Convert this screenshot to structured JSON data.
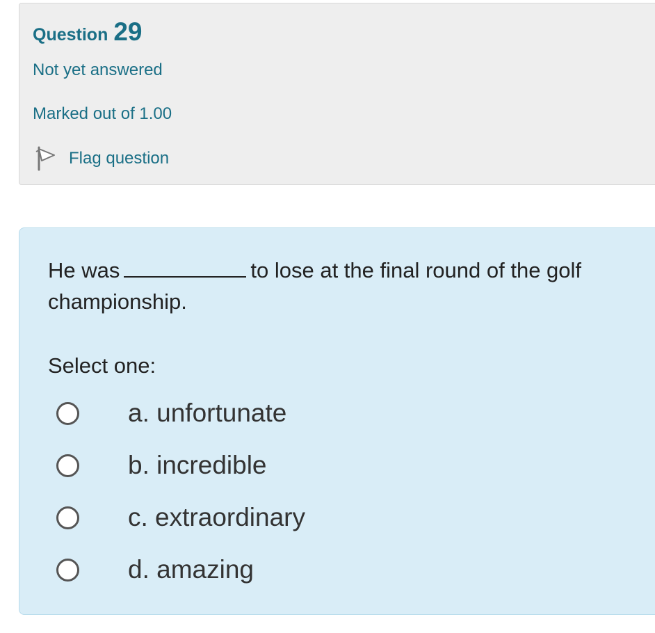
{
  "info": {
    "question_label": "Question",
    "question_number": "29",
    "state": "Not yet answered",
    "grade": "Marked out of 1.00",
    "flag_label": "Flag question"
  },
  "question": {
    "text_before": "He was",
    "text_after": "to lose at the final round of the golf championship.",
    "prompt": "Select one:",
    "options": [
      {
        "label": "a. unfortunate",
        "selected": false
      },
      {
        "label": "b. incredible",
        "selected": false
      },
      {
        "label": "c. extraordinary",
        "selected": false
      },
      {
        "label": "d. amazing",
        "selected": false
      }
    ]
  },
  "colors": {
    "info_background": "#eeeeee",
    "content_background": "#d9edf7",
    "accent_text": "#1a6f86"
  },
  "icons": {
    "flag": "flag-icon",
    "radio": "radio-unchecked-icon"
  }
}
